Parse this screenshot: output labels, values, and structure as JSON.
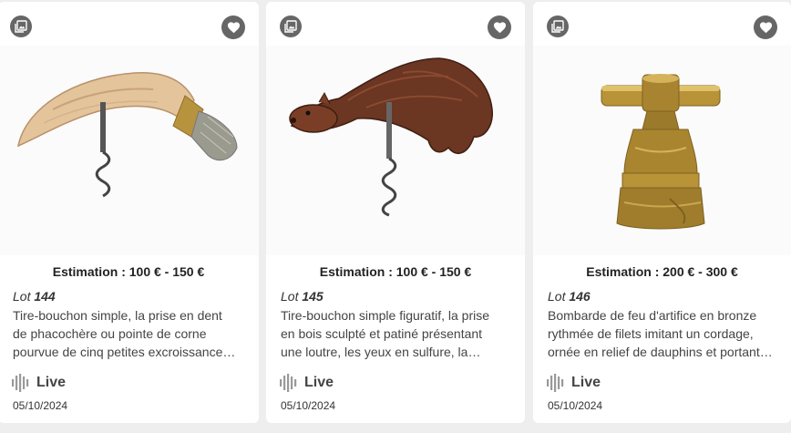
{
  "colors": {
    "page_bg": "#eeeeee",
    "card_bg": "#ffffff",
    "icon_bg": "#666666",
    "text": "#333333"
  },
  "icons": {
    "photo": "photo-icon",
    "favorite": "heart-icon",
    "live": "live-signal-icon"
  },
  "lots": [
    {
      "estimation": "Estimation : 100 € - 150 €",
      "lot_prefix": "Lot",
      "lot_number": "144",
      "description_lines": [
        "Tire-bouchon simple, la prise en dent",
        "de phacochère ou pointe de corne",
        "pourvue de cinq petites excroissance…"
      ],
      "live_label": "Live",
      "date": "05/10/2024"
    },
    {
      "estimation": "Estimation : 100 € - 150 €",
      "lot_prefix": "Lot",
      "lot_number": "145",
      "description_lines": [
        "Tire-bouchon simple figuratif, la prise",
        "en bois sculpté et patiné présentant",
        "une loutre, les yeux en sulfure, la…"
      ],
      "live_label": "Live",
      "date": "05/10/2024"
    },
    {
      "estimation": "Estimation : 200 € - 300 €",
      "lot_prefix": "Lot",
      "lot_number": "146",
      "description_lines": [
        "Bombarde de feu d'artifice en bronze",
        "rythmée de filets imitant un cordage,",
        "ornée en relief de dauphins et portant…"
      ],
      "live_label": "Live",
      "date": "05/10/2024"
    }
  ]
}
